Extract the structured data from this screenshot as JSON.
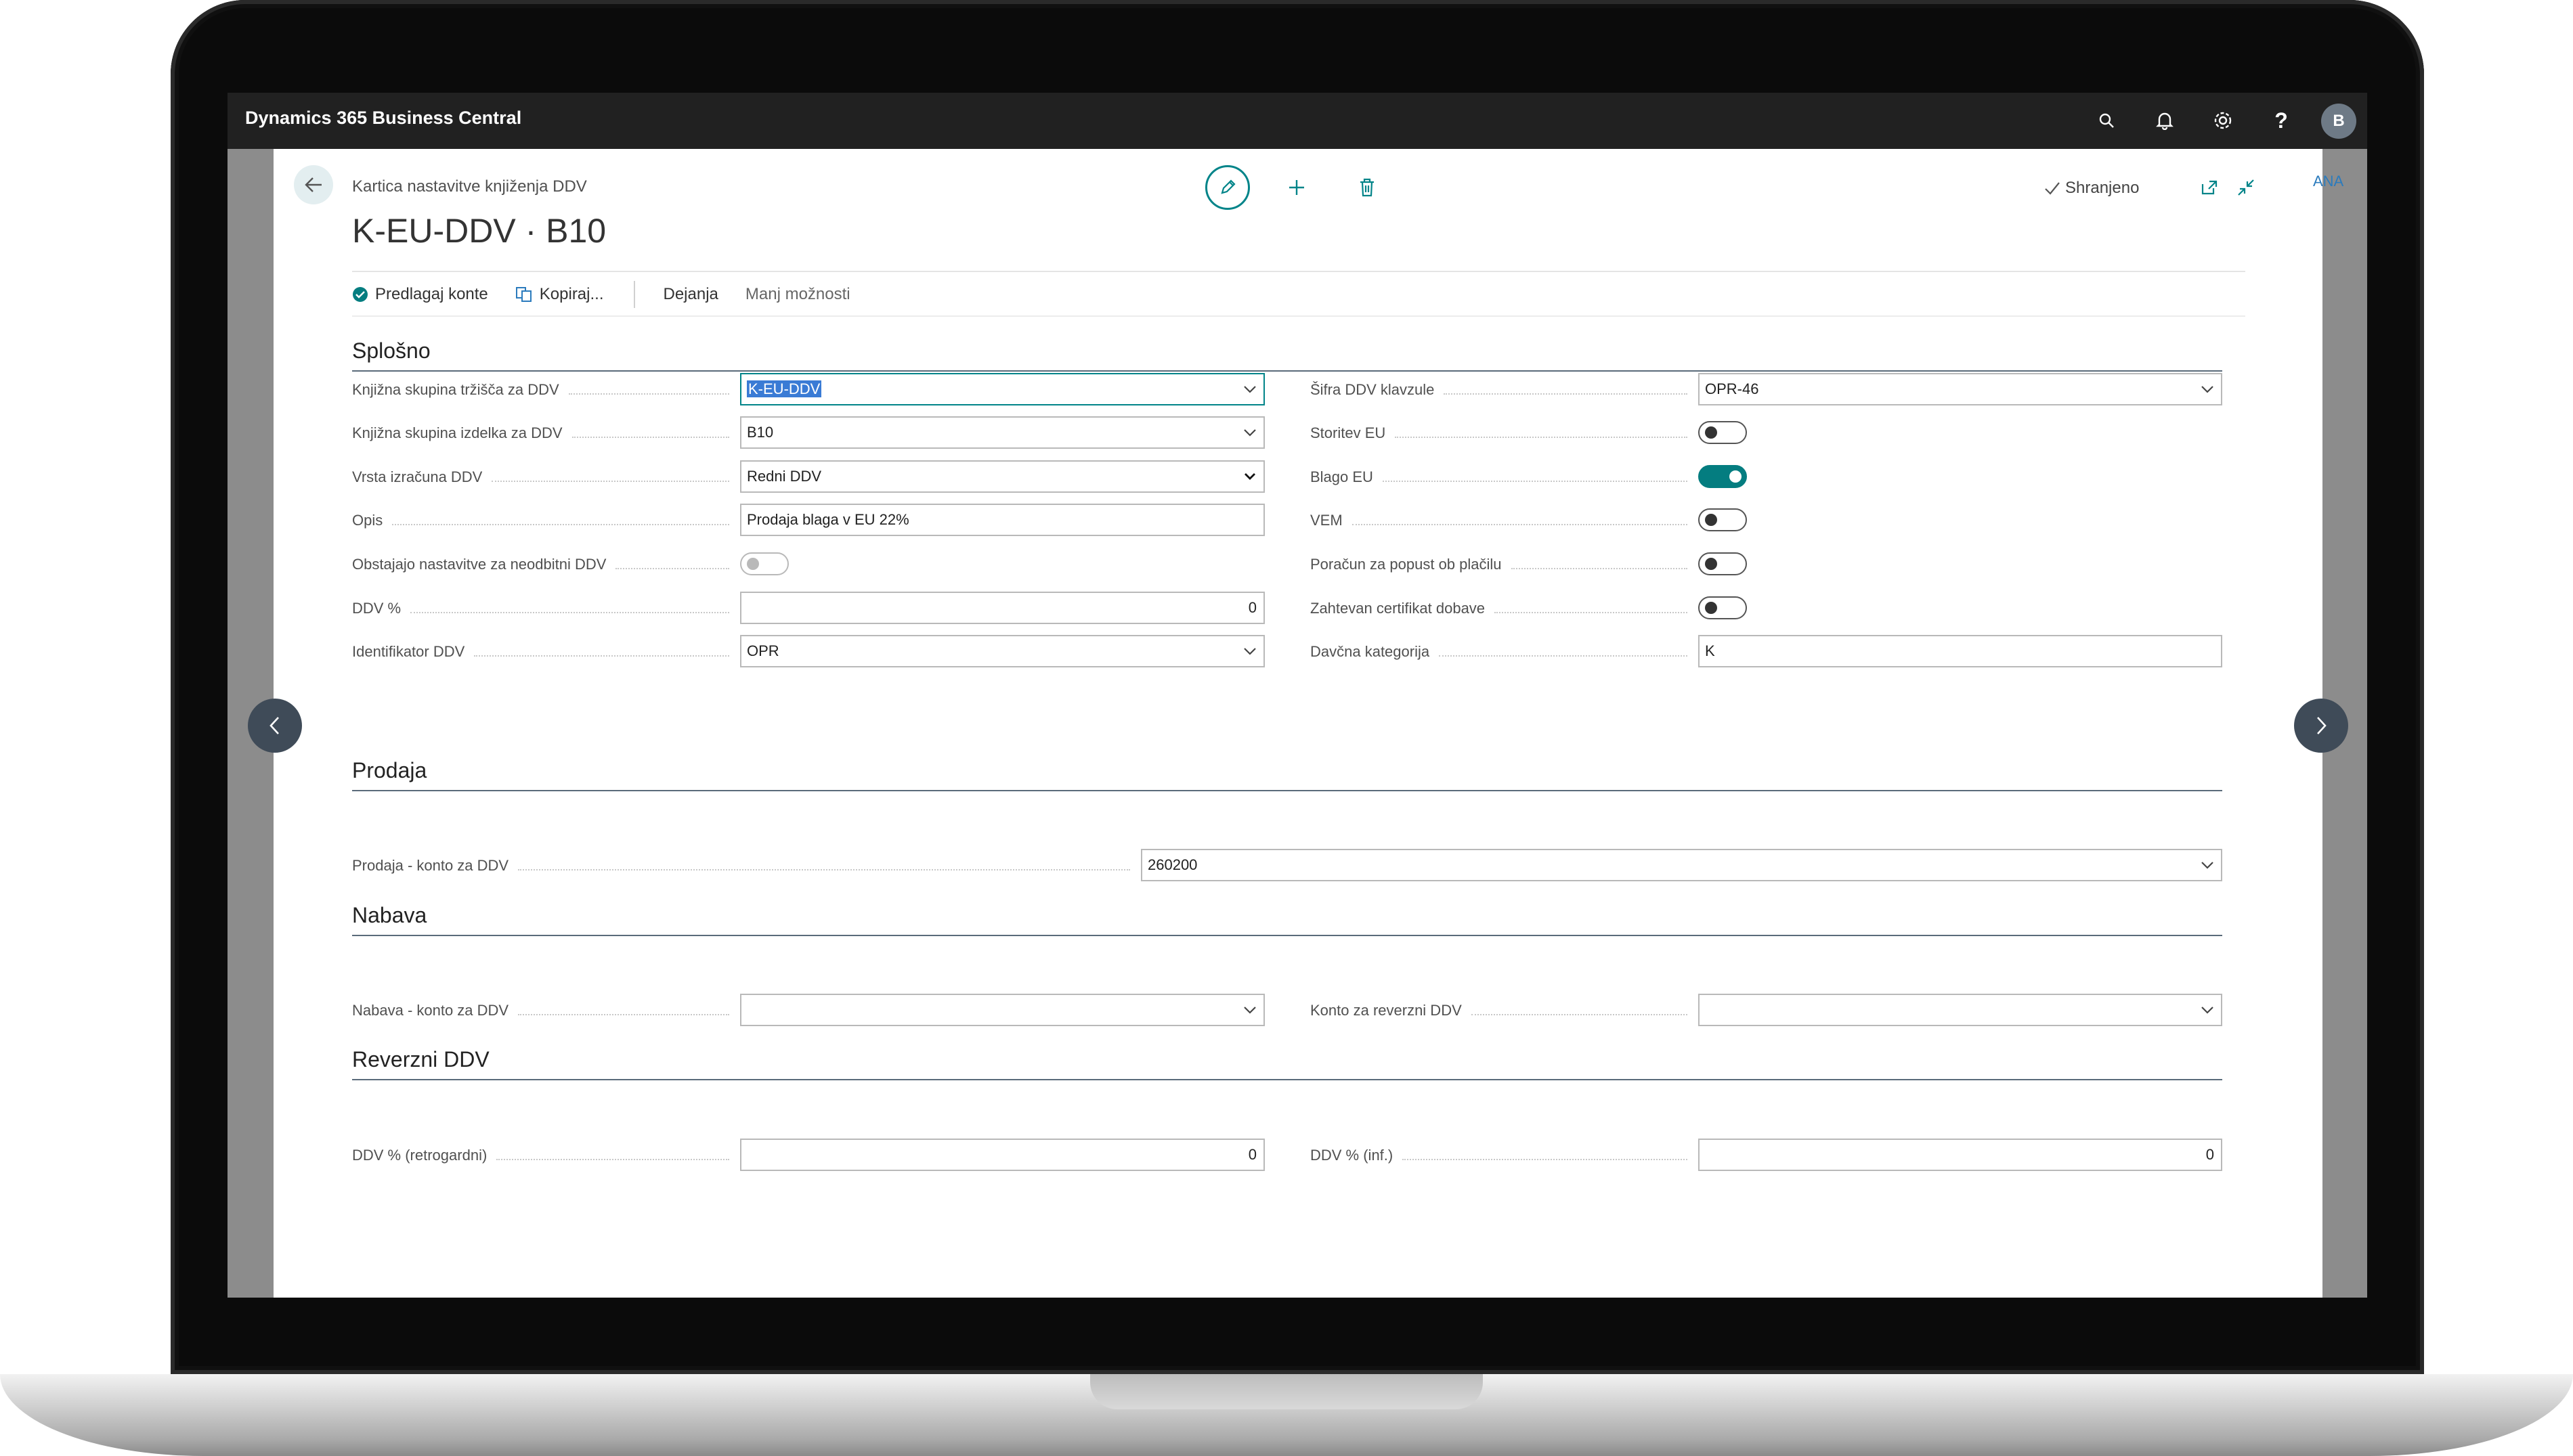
{
  "app": {
    "title": "Dynamics 365 Business Central",
    "avatar_initial": "B",
    "side_label": "ANA"
  },
  "topbar_icons": [
    "search-icon",
    "bell-icon",
    "gear-icon",
    "help-icon"
  ],
  "header": {
    "breadcrumb": "Kartica nastavitve knjiženja DDV",
    "title": "K-EU-DDV · B10",
    "saved_label": "Shranjeno"
  },
  "actions": {
    "suggest": "Predlagaj konte",
    "copy": "Kopiraj...",
    "actions": "Dejanja",
    "fewer": "Manj možnosti"
  },
  "sections": {
    "general": "Splošno",
    "sales": "Prodaja",
    "purchase": "Nabava",
    "reverse": "Reverzni DDV"
  },
  "general_left": [
    {
      "label": "Knjižna skupina tržišča za DDV",
      "value": "K-EU-DDV",
      "kind": "dropdown"
    },
    {
      "label": "Knjižna skupina izdelka za DDV",
      "value": "B10",
      "kind": "dropdown"
    },
    {
      "label": "Vrsta izračuna DDV",
      "value": "Redni DDV",
      "kind": "select"
    },
    {
      "label": "Opis",
      "value": "Prodaja blaga v EU 22%",
      "kind": "text"
    },
    {
      "label": "Obstajajo nastavitve za neodbitni DDV",
      "value": "off",
      "kind": "toggle-disabled"
    },
    {
      "label": "DDV %",
      "value": "0",
      "kind": "number"
    },
    {
      "label": "Identifikator DDV",
      "value": "OPR",
      "kind": "dropdown"
    }
  ],
  "general_right": [
    {
      "label": "Šifra DDV klavzule",
      "value": "OPR-46",
      "kind": "dropdown"
    },
    {
      "label": "Storitev EU",
      "value": "off",
      "kind": "toggle"
    },
    {
      "label": "Blago EU",
      "value": "on",
      "kind": "toggle"
    },
    {
      "label": "VEM",
      "value": "off",
      "kind": "toggle"
    },
    {
      "label": "Poračun za popust ob plačilu",
      "value": "off",
      "kind": "toggle"
    },
    {
      "label": "Zahtevan certifikat dobave",
      "value": "off",
      "kind": "toggle"
    },
    {
      "label": "Davčna kategorija",
      "value": "K",
      "kind": "text"
    }
  ],
  "sales": {
    "label": "Prodaja - konto za DDV",
    "value": "260200"
  },
  "purchase": {
    "left": {
      "label": "Nabava - konto za DDV",
      "value": ""
    },
    "right": {
      "label": "Konto za reverzni DDV",
      "value": ""
    }
  },
  "reverse": {
    "left": {
      "label": "DDV % (retrogardni)",
      "value": "0"
    },
    "right": {
      "label": "DDV % (inf.)",
      "value": "0"
    }
  },
  "colors": {
    "accent": "#008489",
    "topbar": "#212121",
    "toggle_on": "#047d80"
  }
}
